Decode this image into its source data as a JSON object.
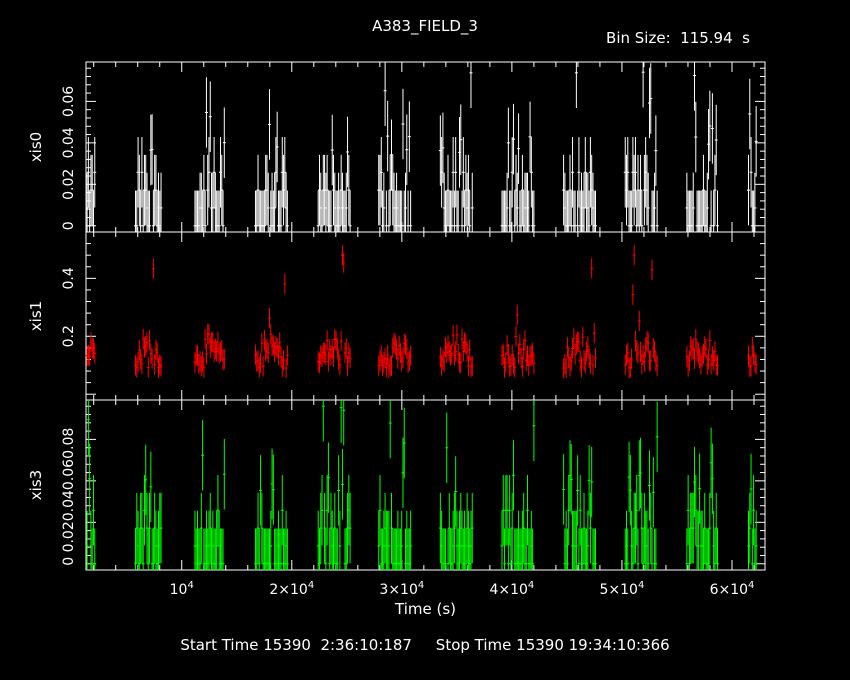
{
  "header": {
    "title": "A383_FIELD_3",
    "bin_size": "Bin Size:  115.94  s"
  },
  "footer": {
    "times": "Start Time 15390  2:36:10:187     Stop Time 15390 19:34:10:366"
  },
  "colors": {
    "background": "#000000",
    "axes": "#ffffff",
    "xis0": "#ffffff",
    "xis1": "#ff0000",
    "xis3": "#00ff00"
  },
  "chart_data": {
    "type": "scatter",
    "xlabel": "Time (s)",
    "xlim": [
      1300,
      63000
    ],
    "x_ticks": [
      {
        "value": 10000,
        "mantissa": "",
        "exp": "4"
      },
      {
        "value": 20000,
        "mantissa": "2",
        "exp": "4"
      },
      {
        "value": 30000,
        "mantissa": "3",
        "exp": "4"
      },
      {
        "value": 40000,
        "mantissa": "4",
        "exp": "4"
      },
      {
        "value": 50000,
        "mantissa": "5",
        "exp": "4"
      },
      {
        "value": 60000,
        "mantissa": "6",
        "exp": "4"
      }
    ],
    "x_tick_prefix": "10",
    "x_tick_times": "×",
    "orbit_windows": [
      [
        1400,
        2200
      ],
      [
        5800,
        8200
      ],
      [
        11200,
        13900
      ],
      [
        16700,
        19600
      ],
      [
        22400,
        25300
      ],
      [
        27900,
        30800
      ],
      [
        33500,
        36400
      ],
      [
        39100,
        42000
      ],
      [
        44700,
        47600
      ],
      [
        50300,
        53200
      ],
      [
        55900,
        58700
      ],
      [
        61500,
        62300
      ]
    ],
    "series": [
      {
        "name": "xis0",
        "ylabel": "xis0",
        "ylim": [
          -0.003,
          0.079
        ],
        "y_ticks": [
          0,
          0.02,
          0.04,
          0.06
        ],
        "y_tick_labels": [
          "0",
          "0.02",
          "0.04",
          "0.06"
        ],
        "err": 0.017,
        "levels": [
          0,
          0.0086,
          0.0172,
          0.0258
        ],
        "peak": 0.075
      },
      {
        "name": "xis1",
        "ylabel": "xis1",
        "ylim": [
          -0.02,
          0.56
        ],
        "y_ticks": [
          0.2,
          0.4
        ],
        "y_tick_labels": [
          "0.2",
          "0.4"
        ],
        "err": 0.035,
        "base": 0.09,
        "spread": 0.12,
        "peak": 0.5
      },
      {
        "name": "xis3",
        "ylabel": "xis3",
        "ylim": [
          -0.003,
          0.079
        ],
        "y_ticks": [
          0,
          0.02,
          0.04,
          0.06
        ],
        "y_tick_labels": [
          "0",
          "0.02",
          "0.04",
          "0.06"
        ],
        "y_tick_text": "0  0.020.040.060.08",
        "err": 0.017,
        "levels": [
          0,
          0.0086,
          0.0172,
          0.0258
        ],
        "peak": 0.078
      }
    ]
  }
}
